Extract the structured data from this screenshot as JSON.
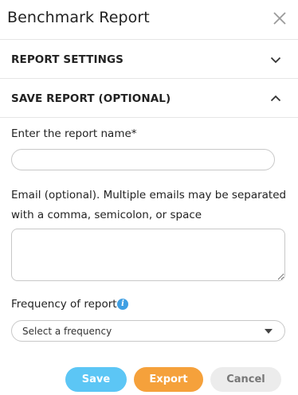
{
  "dialog": {
    "title": "Benchmark Report"
  },
  "sections": {
    "report_settings": {
      "label": "REPORT SETTINGS",
      "state": "collapsed"
    },
    "save_report": {
      "label": "SAVE REPORT (OPTIONAL)",
      "state": "expanded"
    }
  },
  "form": {
    "name_label": "Enter the report name*",
    "name_value": "",
    "email_label": "Email (optional). Multiple emails may be separated with a comma, semicolon, or space",
    "email_value": "",
    "frequency_label": "Frequency of report",
    "frequency_value": "Select a frequency"
  },
  "buttons": {
    "save": "Save",
    "export": "Export",
    "cancel": "Cancel"
  },
  "icons": {
    "close": "close-icon",
    "chevron_down": "chevron-down-icon",
    "chevron_up": "chevron-up-icon",
    "info": "info-icon",
    "caret": "caret-down-icon"
  },
  "colors": {
    "save": "#5cc6f5",
    "export": "#f5a13b",
    "cancel": "#ececec",
    "info": "#3f9fe3"
  }
}
